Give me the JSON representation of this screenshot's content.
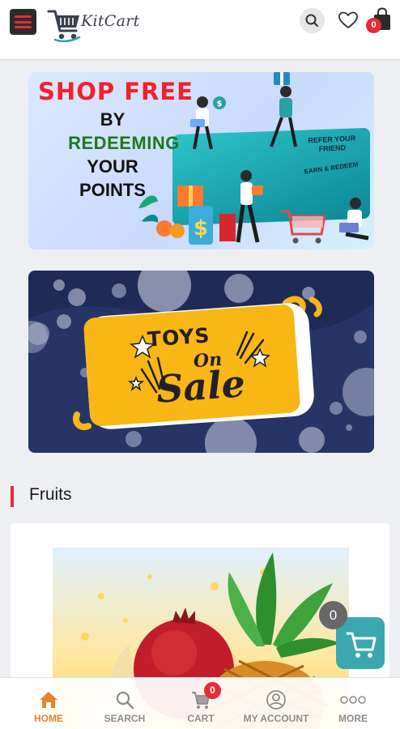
{
  "header": {
    "logo_text": "KitCart",
    "bag_count": "0"
  },
  "banner_refer": {
    "line1": "SHOP FREE",
    "line2": "BY",
    "line3": "REDEEMING",
    "line4": "YOUR",
    "line5": "POINTS",
    "card_refer": "REFER YOUR FRIEND",
    "card_earn": "EARN & REDEEM"
  },
  "banner_toys": {
    "line1": "TOYS",
    "line2": "On",
    "line3": "Sale"
  },
  "section": {
    "title": "Fruits"
  },
  "floating_cart": {
    "count": "0"
  },
  "bottom_nav": {
    "items": [
      {
        "label": "HOME",
        "icon": "home-icon",
        "active": true
      },
      {
        "label": "SEARCH",
        "icon": "search-icon",
        "active": false
      },
      {
        "label": "CART",
        "icon": "cart-icon",
        "active": false
      },
      {
        "label": "MY ACCOUNT",
        "icon": "account-icon",
        "active": false
      },
      {
        "label": "MORE",
        "icon": "more-icon",
        "active": false
      }
    ],
    "cart_count": "0"
  },
  "colors": {
    "accent_red": "#e62d35",
    "active_orange": "#e8822e",
    "teal": "#3aa7b1",
    "page_bg": "#eeeff3"
  }
}
